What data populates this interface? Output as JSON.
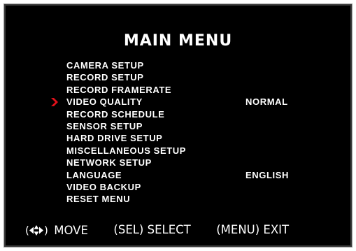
{
  "menu": {
    "title": "MAIN MENU",
    "items": [
      {
        "label": "CAMERA SETUP",
        "value": ""
      },
      {
        "label": "RECORD SETUP",
        "value": ""
      },
      {
        "label": "RECORD FRAMERATE",
        "value": ""
      },
      {
        "label": "VIDEO QUALITY",
        "value": "NORMAL"
      },
      {
        "label": "RECORD SCHEDULE",
        "value": ""
      },
      {
        "label": "SENSOR SETUP",
        "value": ""
      },
      {
        "label": "HARD DRIVE SETUP",
        "value": ""
      },
      {
        "label": "MISCELLANEOUS SETUP",
        "value": ""
      },
      {
        "label": "NETWORK SETUP",
        "value": ""
      },
      {
        "label": "LANGUAGE",
        "value": "ENGLISH"
      },
      {
        "label": "VIDEO BACKUP",
        "value": ""
      },
      {
        "label": "RESET MENU",
        "value": ""
      }
    ],
    "selected_index": 3
  },
  "footer": {
    "move_open": "(",
    "move_close": ")",
    "move_label": "MOVE",
    "select_hint": "(SEL) SELECT",
    "exit_hint": "(MENU) EXIT"
  },
  "colors": {
    "background": "#000000",
    "text": "#ffffff",
    "cursor": "#e0101a"
  },
  "icons": {
    "cursor": "selection-arrow-icon",
    "navigation": "four-way-arrows-icon"
  }
}
